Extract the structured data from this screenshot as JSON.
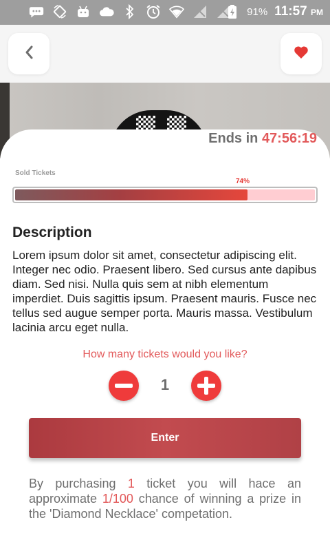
{
  "status_bar": {
    "battery": "91%",
    "time": "11:57",
    "ampm": "PM",
    "icons": [
      "message-icon",
      "rotate-icon",
      "android-icon",
      "cloud-icon",
      "bluetooth-icon",
      "alarm-icon",
      "wifi-icon",
      "no-signal-icon",
      "no-signal-icon",
      "battery-charging-icon"
    ]
  },
  "header": {
    "back_icon": "chevron-left-icon",
    "favorite_icon": "heart-icon"
  },
  "countdown": {
    "prefix": "Ends in",
    "time": "47:56:19"
  },
  "sold_tickets": {
    "label": "Sold Tickets",
    "percent_text": "74%",
    "fraction": 0.775
  },
  "description": {
    "title": "Description",
    "body": "Lorem ipsum dolor sit amet, consectetur adipiscing elit. Integer nec odio. Praesent libero. Sed cursus ante dapibus diam. Sed nisi. Nulla quis sem at nibh elementum imperdiet. Duis sagittis ipsum. Praesent mauris. Fusce nec tellus sed augue semper porta. Mauris massa. Vestibulum lacinia arcu eget nulla."
  },
  "tickets": {
    "question": "How many tickets would you like?",
    "quantity": "1"
  },
  "enter_label": "Enter",
  "purchase_info": {
    "part1": "By purchasing ",
    "count": "1",
    "part2": " ticket you will hace an approximate ",
    "odds": "1/100",
    "part3": " chance of winning a prize in the 'Diamond Necklace' competation."
  },
  "colors": {
    "accent": "#e2595a",
    "button": "#b8454a",
    "stepper": "#ef3b3b",
    "progress_track": "#ffcdd2"
  }
}
